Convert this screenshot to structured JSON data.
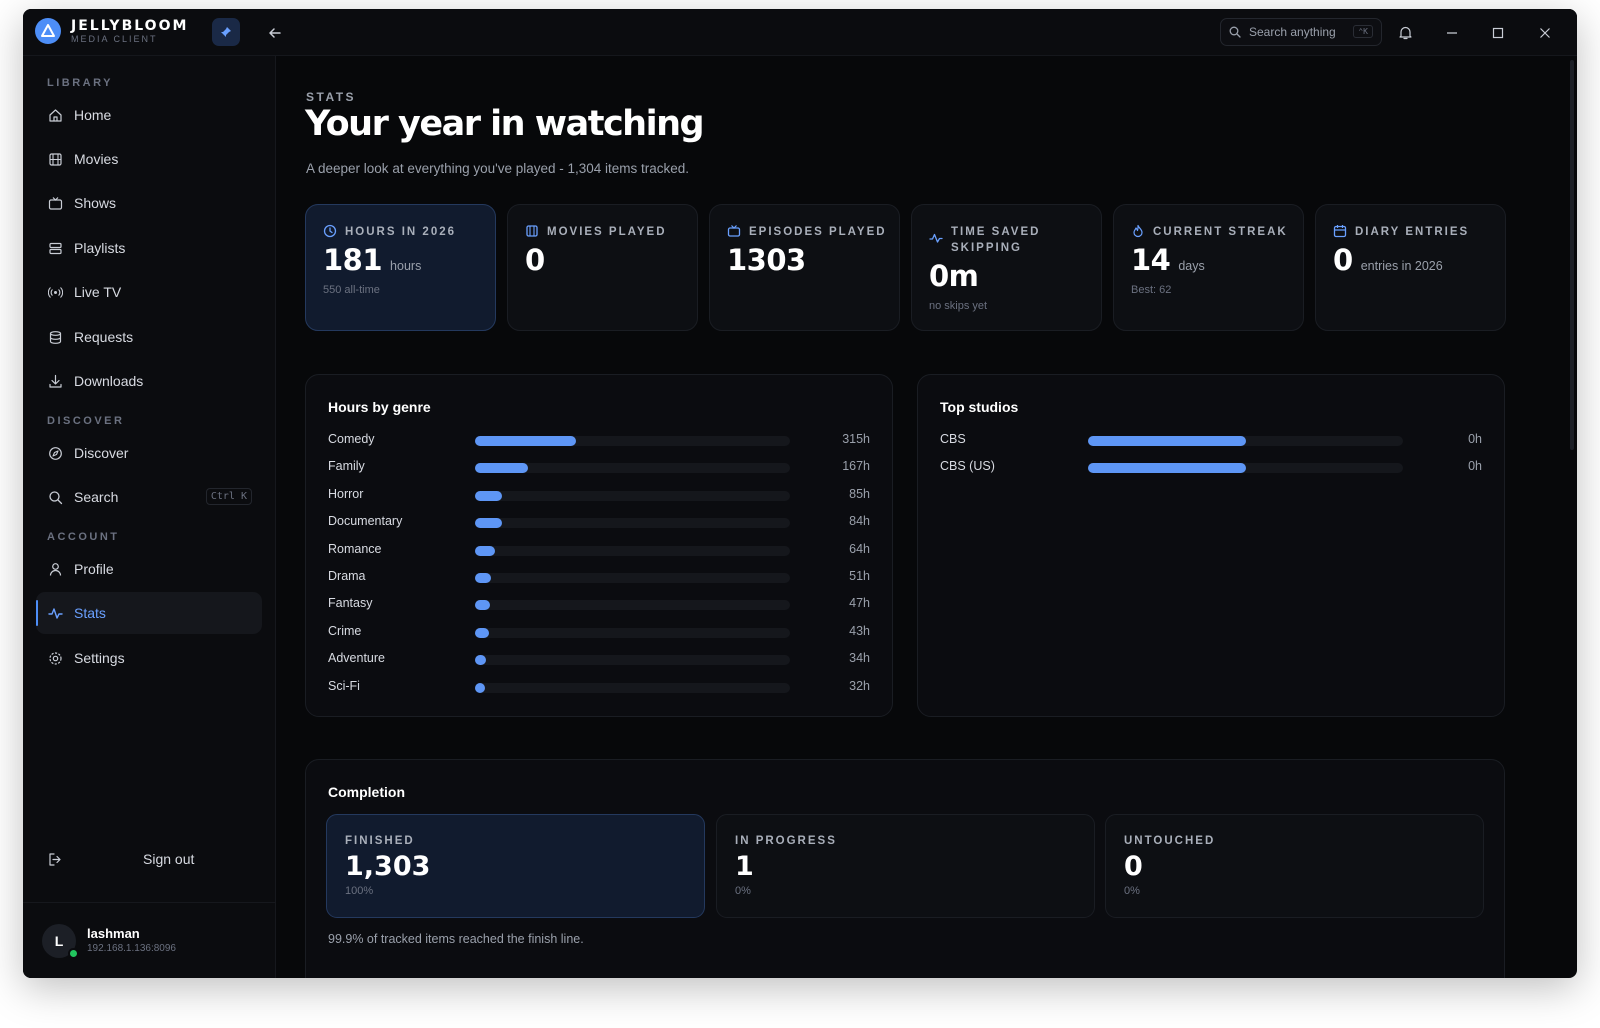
{
  "app": {
    "name": "JELLYBLOOM",
    "subtitle": "MEDIA CLIENT"
  },
  "titlebar": {
    "search_placeholder": "Search anything",
    "search_shortcut": "⌃K"
  },
  "sidebar": {
    "sections": {
      "library": "LIBRARY",
      "discover": "DISCOVER",
      "account": "ACCOUNT"
    },
    "library_items": [
      "Home",
      "Movies",
      "Shows",
      "Playlists",
      "Live TV",
      "Requests",
      "Downloads"
    ],
    "discover_items": [
      "Discover",
      "Search"
    ],
    "search_shortcut": "Ctrl K",
    "account_items": [
      "Profile",
      "Stats",
      "Settings"
    ],
    "active_item": "Stats",
    "sign_out": "Sign out",
    "user": {
      "initial": "L",
      "name": "lashman",
      "host": "192.168.1.136:8096",
      "status_color": "#22c55e"
    }
  },
  "page": {
    "eyebrow": "STATS",
    "title": "Your year in watching",
    "subtitle": "A deeper look at everything you've played - 1,304 items tracked."
  },
  "stats": [
    {
      "icon": "clock-icon",
      "label": "HOURS IN 2026",
      "value": "181",
      "unit": "hours",
      "note": "550 all-time"
    },
    {
      "icon": "film-icon",
      "label": "MOVIES PLAYED",
      "value": "0",
      "unit": "",
      "note": ""
    },
    {
      "icon": "tv-icon",
      "label": "EPISODES PLAYED",
      "value": "1303",
      "unit": "",
      "note": ""
    },
    {
      "icon": "activity-icon",
      "label": "TIME SAVED SKIPPING",
      "value": "0m",
      "unit": "",
      "note": "no skips yet"
    },
    {
      "icon": "flame-icon",
      "label": "CURRENT STREAK",
      "value": "14",
      "unit": "days",
      "note": "Best: 62"
    },
    {
      "icon": "calendar-icon",
      "label": "DIARY ENTRIES",
      "value": "0",
      "unit": "entries in 2026",
      "note": ""
    }
  ],
  "genres": {
    "title": "Hours by genre",
    "max": 315,
    "items": [
      {
        "name": "Comedy",
        "hours": 315,
        "label": "315h"
      },
      {
        "name": "Family",
        "hours": 167,
        "label": "167h"
      },
      {
        "name": "Horror",
        "hours": 85,
        "label": "85h"
      },
      {
        "name": "Documentary",
        "hours": 84,
        "label": "84h"
      },
      {
        "name": "Romance",
        "hours": 64,
        "label": "64h"
      },
      {
        "name": "Drama",
        "hours": 51,
        "label": "51h"
      },
      {
        "name": "Fantasy",
        "hours": 47,
        "label": "47h"
      },
      {
        "name": "Crime",
        "hours": 43,
        "label": "43h"
      },
      {
        "name": "Adventure",
        "hours": 34,
        "label": "34h"
      },
      {
        "name": "Sci-Fi",
        "hours": 32,
        "label": "32h"
      }
    ]
  },
  "studios": {
    "title": "Top studios",
    "items": [
      {
        "name": "CBS",
        "fill_fraction": 0.5,
        "label": "0h"
      },
      {
        "name": "CBS (US)",
        "fill_fraction": 0.5,
        "label": "0h"
      }
    ]
  },
  "completion": {
    "title": "Completion",
    "cards": [
      {
        "label": "FINISHED",
        "value": "1,303",
        "pct": "100%"
      },
      {
        "label": "IN PROGRESS",
        "value": "1",
        "pct": "0%"
      },
      {
        "label": "UNTOUCHED",
        "value": "0",
        "pct": "0%"
      }
    ],
    "footnote": "99.9% of tracked items reached the finish line."
  },
  "colors": {
    "accent": "#5e96f5",
    "background": "#07080a",
    "panel": "#0b0c10"
  }
}
